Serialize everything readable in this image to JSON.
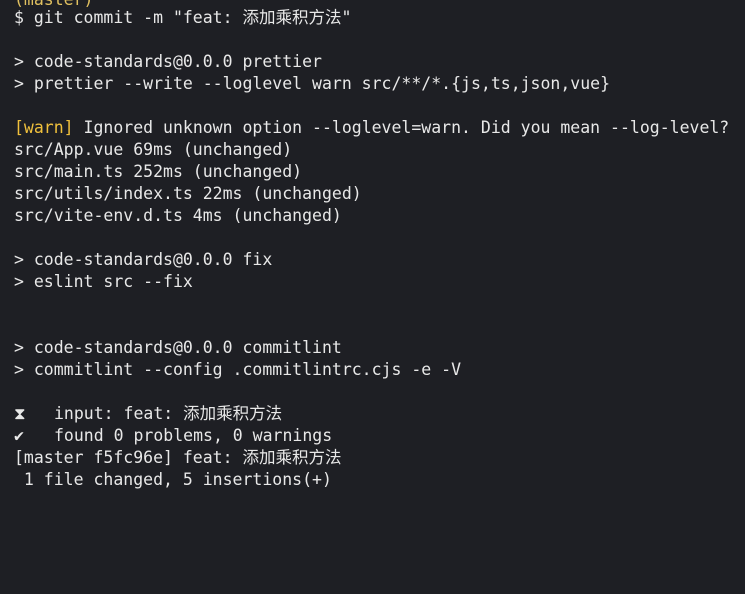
{
  "terminal": {
    "lines": [
      {
        "text": "(master)"
      },
      {
        "text": "$ git commit -m \"feat: 添加乘积方法\""
      },
      {
        "text": ""
      },
      {
        "text": "> code-standards@0.0.0 prettier"
      },
      {
        "text": "> prettier --write --loglevel warn src/**/*.{js,ts,json,vue}"
      },
      {
        "text": ""
      },
      {
        "warn_tag": "[warn]",
        "text": " Ignored unknown option --loglevel=warn. Did you mean --log-level?"
      },
      {
        "text": "src/App.vue 69ms (unchanged)"
      },
      {
        "text": "src/main.ts 252ms (unchanged)"
      },
      {
        "text": "src/utils/index.ts 22ms (unchanged)"
      },
      {
        "text": "src/vite-env.d.ts 4ms (unchanged)"
      },
      {
        "text": ""
      },
      {
        "text": "> code-standards@0.0.0 fix"
      },
      {
        "text": "> eslint src --fix"
      },
      {
        "text": ""
      },
      {
        "text": ""
      },
      {
        "text": "> code-standards@0.0.0 commitlint"
      },
      {
        "text": "> commitlint --config .commitlintrc.cjs -e -V"
      },
      {
        "text": ""
      },
      {
        "icon": "⧗",
        "icon_name": "hourglass-icon",
        "text": "input: feat: 添加乘积方法"
      },
      {
        "icon": "✔",
        "icon_name": "check-icon",
        "text": "found 0 problems, 0 warnings"
      },
      {
        "text": "[master f5fc96e] feat: 添加乘积方法"
      },
      {
        "text": " 1 file changed, 5 insertions(+)"
      }
    ],
    "colors": {
      "background": "#1e1f24",
      "text": "#e8e8e8",
      "warn": "#f0c03c"
    }
  }
}
